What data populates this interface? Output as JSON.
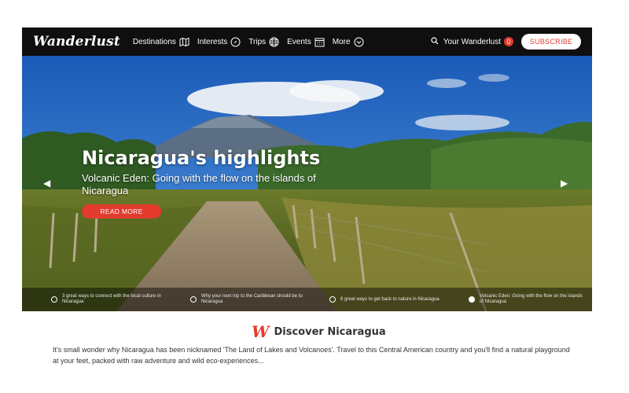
{
  "nav": {
    "logo": "Wanderlust",
    "items": [
      {
        "label": "Destinations",
        "icon": "map-icon"
      },
      {
        "label": "Interests",
        "icon": "compass-icon"
      },
      {
        "label": "Trips",
        "icon": "globe-icon"
      },
      {
        "label": "Events",
        "icon": "calendar-icon"
      },
      {
        "label": "More",
        "icon": "chevron-down-icon"
      }
    ],
    "your_wanderlust": "Your Wanderlust",
    "badge_count": "0",
    "subscribe": "SUBSCRIBE"
  },
  "hero": {
    "title": "Nicaragua's highlights",
    "subtitle": "Volcanic Eden: Going with the flow on the islands of Nicaragua",
    "cta": "READ MORE",
    "slides": [
      {
        "text": "3 great ways to connect with the local culture in Nicaragua",
        "active": false
      },
      {
        "text": "Why your next trip to the Caribbean should be to Nicaragua",
        "active": false
      },
      {
        "text": "6 great ways to get back to nature in Nicaragua",
        "active": false
      },
      {
        "text": "Volcanic Eden: Going with the flow on the islands of Nicaragua",
        "active": true
      }
    ]
  },
  "discover": {
    "logo_letter": "W",
    "title": "Discover Nicaragua",
    "intro": "It's small wonder why Nicaragua has been nicknamed 'The Land of Lakes and Volcanoes'. Travel to this Central American country and you'll find a natural playground at your feet, packed with raw adventure and wild eco-experiences..."
  },
  "colors": {
    "accent": "#e33b2e",
    "nav_bg": "#0f0f0f"
  }
}
